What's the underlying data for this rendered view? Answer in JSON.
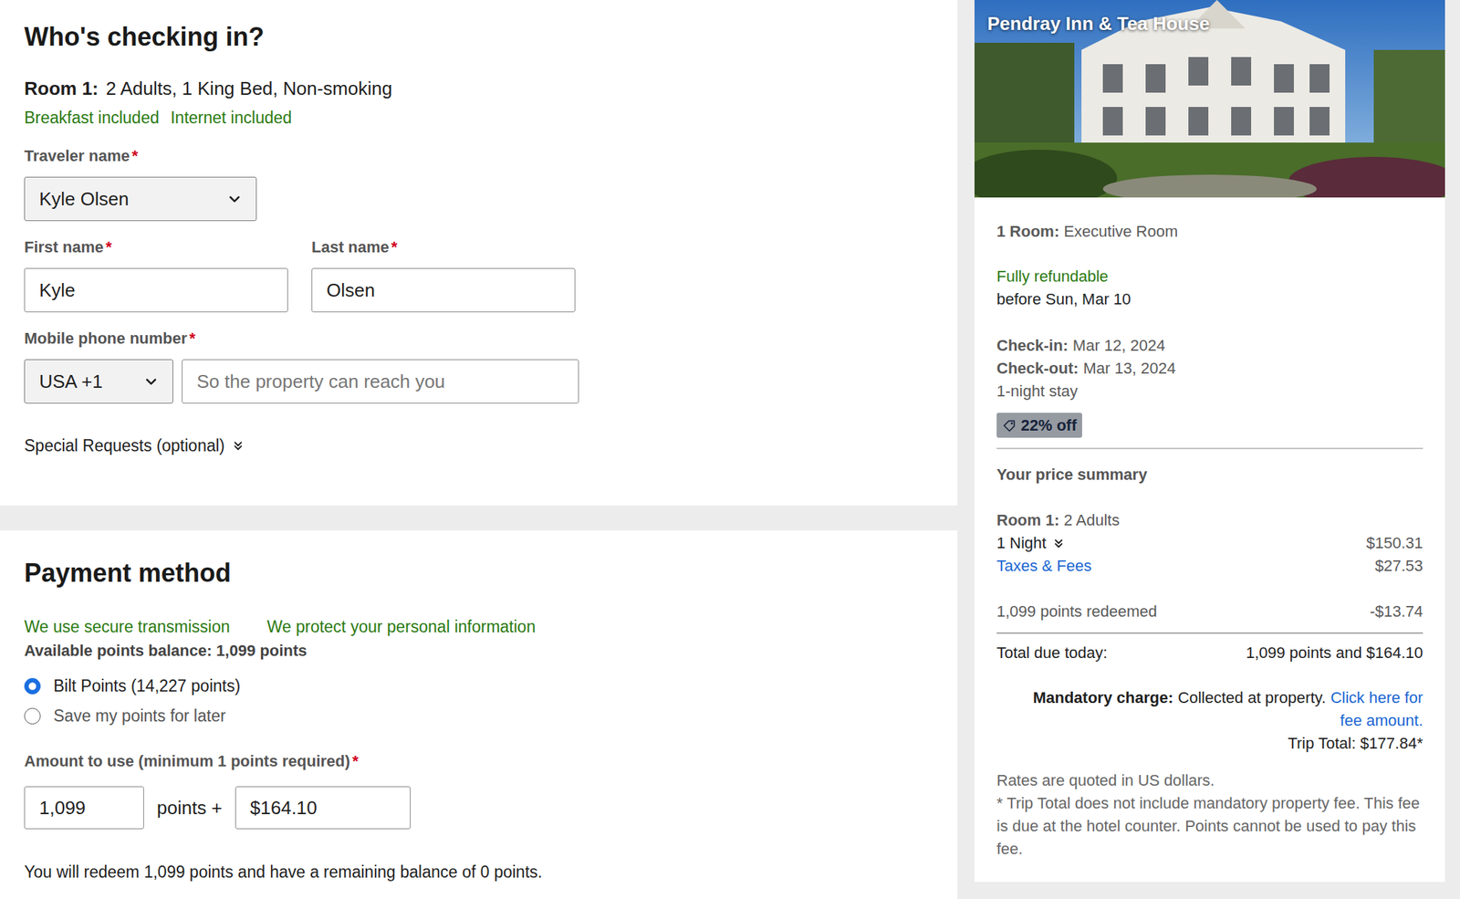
{
  "checkin": {
    "heading": "Who's checking in?",
    "room": {
      "label": "Room 1:",
      "desc": "2 Adults, 1 King Bed, Non-smoking"
    },
    "perks": [
      "Breakfast included",
      "Internet included"
    ],
    "required_mark": "*",
    "traveler": {
      "label": "Traveler name",
      "value": "Kyle Olsen"
    },
    "first_name": {
      "label": "First name",
      "value": "Kyle"
    },
    "last_name": {
      "label": "Last name",
      "value": "Olsen"
    },
    "phone": {
      "label": "Mobile phone number",
      "country": "USA +1",
      "placeholder": "So the property can reach you"
    },
    "special_requests": {
      "label": "Special Requests (optional)",
      "expanded": false
    }
  },
  "payment": {
    "heading": "Payment method",
    "assurances": [
      "We use secure transmission",
      "We protect your personal information"
    ],
    "balance": "Available points balance: 1,099 points",
    "options": [
      {
        "label": "Bilt Points (14,227 points)",
        "selected": true
      },
      {
        "label": "Save my points for later",
        "selected": false
      }
    ],
    "amount_label": "Amount to use (minimum 1 points required)",
    "points_value": "1,099",
    "points_joiner": "points +",
    "cash_value": "$164.10",
    "summary": "You will redeem 1,099 points and have a remaining balance of 0 points."
  },
  "sidebar": {
    "hotel_name": "Pendray Inn & Tea House",
    "room": {
      "label": "1 Room:",
      "value": "Executive Room"
    },
    "refund": {
      "status": "Fully refundable",
      "deadline": "before Sun, Mar 10"
    },
    "dates": [
      {
        "label": "Check-in:",
        "value": "Mar 12, 2024"
      },
      {
        "label": "Check-out:",
        "value": "Mar 13, 2024"
      }
    ],
    "stay": "1-night stay",
    "discount": "22% off",
    "summary_title": "Your price summary",
    "price_room": {
      "label": "Room 1:",
      "value": "2 Adults"
    },
    "lines": [
      {
        "label": "1 Night",
        "amount": "$150.31",
        "kind": "expander"
      },
      {
        "label": "Taxes & Fees",
        "amount": "$27.53",
        "kind": "link"
      }
    ],
    "redeemed": {
      "label": "1,099 points redeemed",
      "amount": "-$13.74"
    },
    "total": {
      "label": "Total due today:",
      "amount": "1,099 points and $164.10"
    },
    "mandatory": {
      "label": "Mandatory charge:",
      "text": "Collected at property.",
      "link": "Click here for fee amount."
    },
    "trip_total": "Trip Total: $177.84*",
    "notes": [
      "Rates are quoted in US dollars.",
      "* Trip Total does not include mandatory property fee. This fee is due at the hotel counter. Points cannot be used to pay this fee."
    ]
  }
}
